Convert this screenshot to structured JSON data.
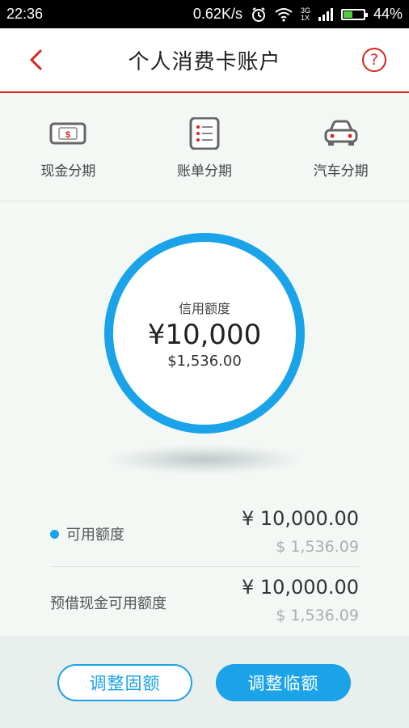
{
  "status_bar": {
    "time": "22:36",
    "speed": "0.62K/s",
    "network_top": "3G",
    "network_bottom": "1X",
    "battery": "44%",
    "battery_level": 0.44
  },
  "header": {
    "title": "个人消费卡账户",
    "help": "?"
  },
  "shortcuts": [
    {
      "label": "现金分期",
      "icon": "cash-icon"
    },
    {
      "label": "账单分期",
      "icon": "bill-icon"
    },
    {
      "label": "汽车分期",
      "icon": "car-icon"
    }
  ],
  "credit": {
    "label": "信用额度",
    "amount": "¥10,000",
    "usd": "$1,536.00"
  },
  "quotas": [
    {
      "name": "可用额度",
      "amount": "¥ 10,000.00",
      "usd": "$ 1,536.09"
    },
    {
      "name": "预借现金可用额度",
      "amount": "¥ 10,000.00",
      "usd": "$ 1,536.09"
    }
  ],
  "buttons": {
    "fixed": "调整固额",
    "temporary": "调整临额"
  },
  "colors": {
    "accent": "#1aa3e8",
    "brand_red": "#d9231f"
  }
}
